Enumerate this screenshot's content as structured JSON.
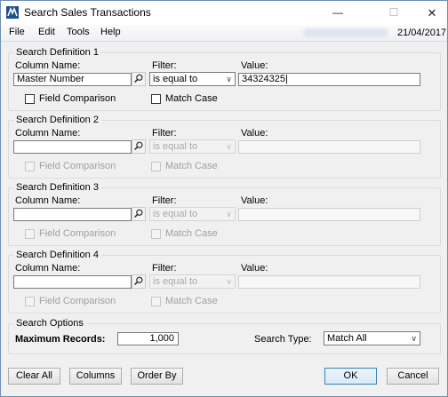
{
  "window": {
    "title": "Search Sales Transactions",
    "min_glyph": "—",
    "max_glyph": "☐",
    "close_glyph": "✕"
  },
  "menu": {
    "items": [
      "File",
      "Edit",
      "Tools",
      "Help"
    ],
    "date": "21/04/2017"
  },
  "labels": {
    "column_name": "Column Name:",
    "filter": "Filter:",
    "value": "Value:",
    "field_comparison": "Field Comparison",
    "match_case": "Match Case"
  },
  "definitions": [
    {
      "title": "Search Definition 1",
      "column": "Master Number",
      "filter": "is equal to",
      "value": "34324325|",
      "enabled": true
    },
    {
      "title": "Search Definition 2",
      "column": "",
      "filter": "is equal to",
      "value": "",
      "enabled": false
    },
    {
      "title": "Search Definition 3",
      "column": "",
      "filter": "is equal to",
      "value": "",
      "enabled": false
    },
    {
      "title": "Search Definition 4",
      "column": "",
      "filter": "is equal to",
      "value": "",
      "enabled": false
    }
  ],
  "options": {
    "title": "Search Options",
    "max_records_label": "Maximum Records:",
    "max_records": "1,000",
    "search_type_label": "Search Type:",
    "search_type": "Match All"
  },
  "buttons": {
    "clear_all": "Clear All",
    "columns": "Columns",
    "order_by": "Order By",
    "ok": "OK",
    "cancel": "Cancel"
  },
  "icons": {
    "app": "dynamics-gp-icon",
    "lookup": "magnifier-icon",
    "dropdown": "chevron-down-icon"
  }
}
